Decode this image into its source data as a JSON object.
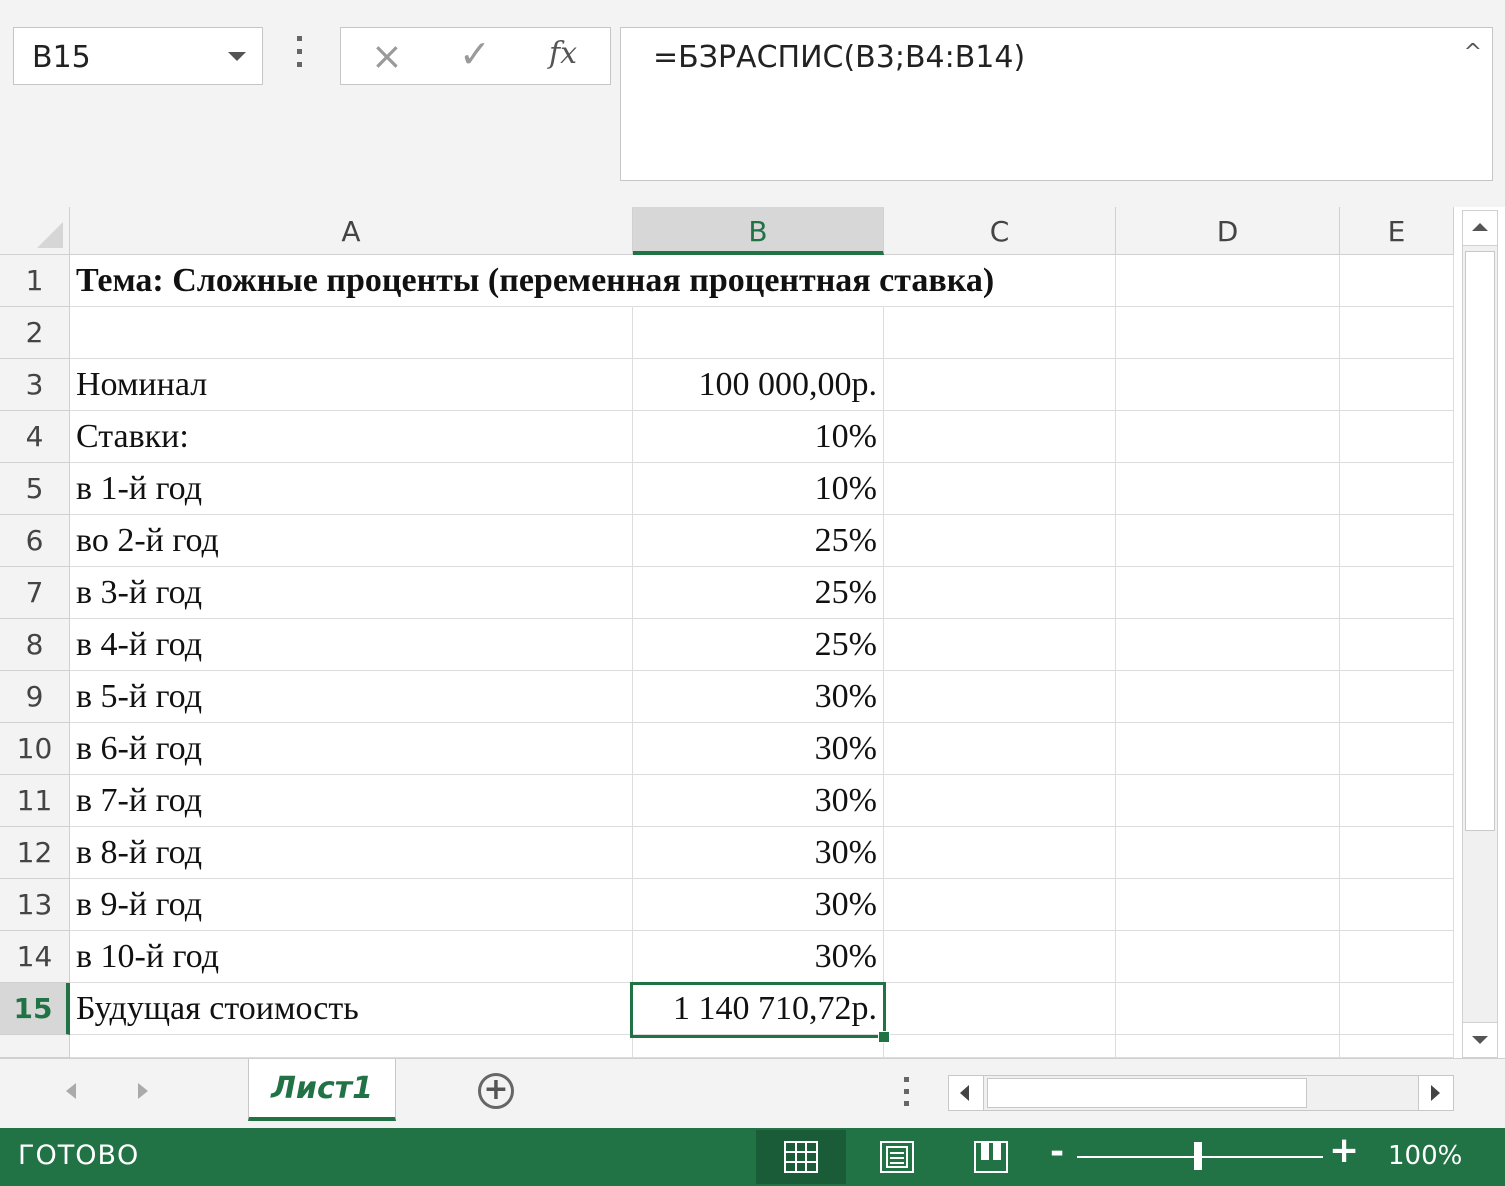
{
  "name_box": "B15",
  "formula": "=БЗРАСПИС(B3;B4:B14)",
  "formula_icons": {
    "cancel": "×",
    "enter": "✓",
    "fx": "fx",
    "collapse": "^"
  },
  "columns": [
    {
      "label": "A",
      "selected": false
    },
    {
      "label": "B",
      "selected": true
    },
    {
      "label": "C",
      "selected": false
    },
    {
      "label": "D",
      "selected": false
    },
    {
      "label": "E",
      "selected": false
    }
  ],
  "rows": [
    {
      "n": "1",
      "a": "Тема: Сложные проценты (переменная процентная ставка)",
      "b": ""
    },
    {
      "n": "2",
      "a": "",
      "b": ""
    },
    {
      "n": "3",
      "a": "Номинал",
      "b": "100 000,00р."
    },
    {
      "n": "4",
      "a": "Ставки:",
      "b": "10%"
    },
    {
      "n": "5",
      "a": "в 1-й год",
      "b": "10%"
    },
    {
      "n": "6",
      "a": "во 2-й год",
      "b": "25%"
    },
    {
      "n": "7",
      "a": "в 3-й год",
      "b": "25%"
    },
    {
      "n": "8",
      "a": "в 4-й год",
      "b": "25%"
    },
    {
      "n": "9",
      "a": "в 5-й год",
      "b": "30%"
    },
    {
      "n": "10",
      "a": "в 6-й год",
      "b": "30%"
    },
    {
      "n": "11",
      "a": "в 7-й год",
      "b": "30%"
    },
    {
      "n": "12",
      "a": "в 8-й год",
      "b": "30%"
    },
    {
      "n": "13",
      "a": "в 9-й год",
      "b": "30%"
    },
    {
      "n": "14",
      "a": "в 10-й год",
      "b": "30%"
    },
    {
      "n": "15",
      "a": "Будущая стоимость",
      "b": "1 140 710,72р."
    }
  ],
  "sheet_tab": "Лист1",
  "status": "ГОТОВО",
  "zoom": "100%",
  "colors": {
    "accent": "#217346"
  }
}
